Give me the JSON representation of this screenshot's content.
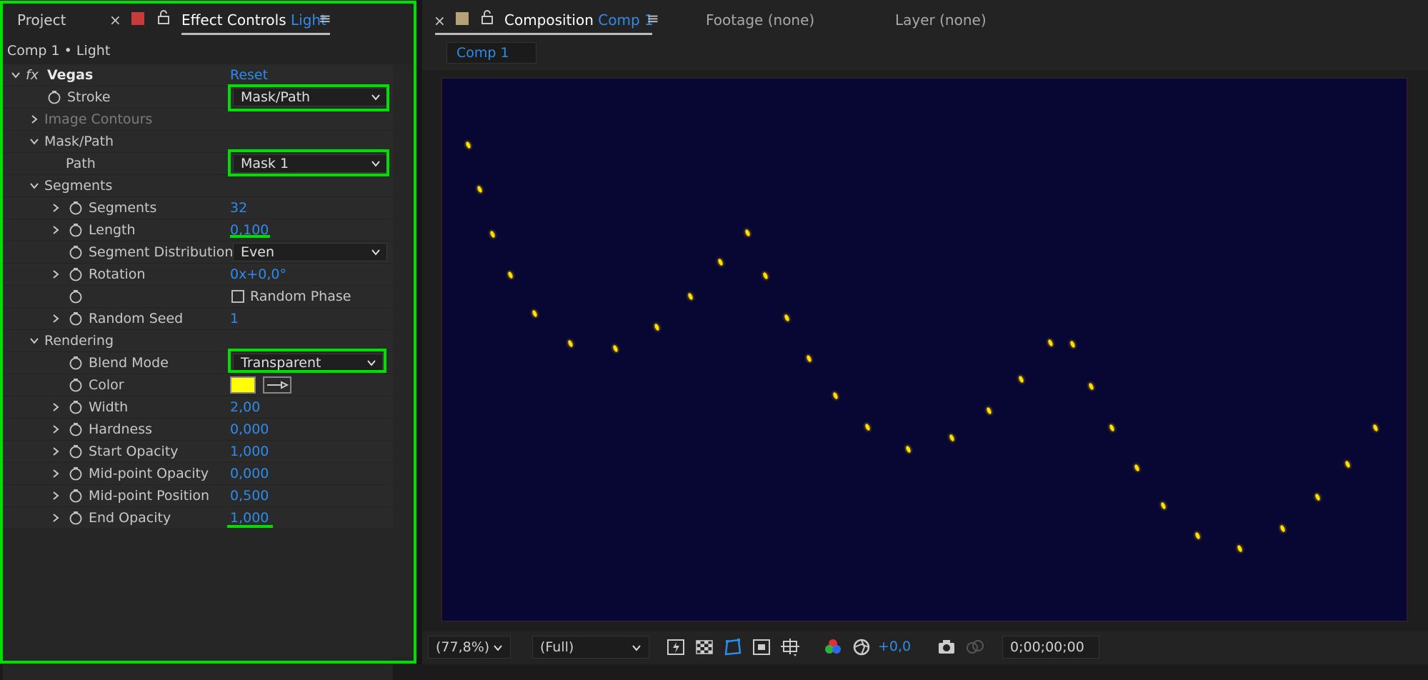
{
  "left_tabs": {
    "project": "Project",
    "effect_controls": "Effect Controls",
    "effect_layer": "Light"
  },
  "breadcrumb": "Comp 1 • Light",
  "effect": {
    "name": "Vegas",
    "reset": "Reset"
  },
  "props": {
    "stroke": {
      "label": "Stroke",
      "value": "Mask/Path"
    },
    "image_contours": "Image Contours",
    "mask_path_group": "Mask/Path",
    "path": {
      "label": "Path",
      "value": "Mask 1"
    },
    "segments_group": "Segments",
    "segments": {
      "label": "Segments",
      "value": "32"
    },
    "length": {
      "label": "Length",
      "value": "0,100"
    },
    "segment_distribution": {
      "label": "Segment Distribution",
      "value": "Even"
    },
    "rotation": {
      "label": "Rotation",
      "value": "0x+0,0°"
    },
    "random_phase": "Random Phase",
    "random_seed": {
      "label": "Random Seed",
      "value": "1"
    },
    "rendering_group": "Rendering",
    "blend_mode": {
      "label": "Blend Mode",
      "value": "Transparent"
    },
    "color": {
      "label": "Color",
      "swatch": "#ffff00"
    },
    "width": {
      "label": "Width",
      "value": "2,00"
    },
    "hardness": {
      "label": "Hardness",
      "value": "0,000"
    },
    "start_opacity": {
      "label": "Start Opacity",
      "value": "1,000"
    },
    "midpoint_opacity": {
      "label": "Mid-point Opacity",
      "value": "0,000"
    },
    "midpoint_position": {
      "label": "Mid-point Position",
      "value": "0,500"
    },
    "end_opacity": {
      "label": "End Opacity",
      "value": "1,000"
    }
  },
  "right_tabs": {
    "composition": "Composition",
    "comp_name": "Comp 1",
    "footage": "Footage (none)",
    "layer": "Layer (none)"
  },
  "comp_tab": "Comp 1",
  "viewer_bar": {
    "zoom": "(77,8%)",
    "resolution": "(Full)",
    "exposure": "+0,0",
    "timecode": "0;00;00;00"
  },
  "colors": {
    "highlight": "#00e000",
    "accent": "#2d8ceb",
    "comp_bg": "#080632",
    "dot": "#ffe000"
  }
}
